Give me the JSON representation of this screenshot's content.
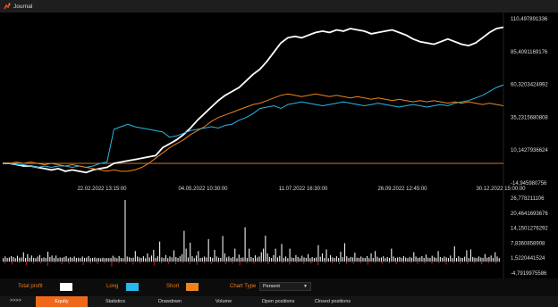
{
  "window": {
    "title": "Journal"
  },
  "chart_data": [
    {
      "type": "line",
      "title": "",
      "x_tick_labels": [
        "22.02.2022 13:15:00",
        "04.05.2022 10:30:00",
        "11.07.2022 16:30:00",
        "26.09.2022 12:45:00",
        "30.12.2022 15:00:00"
      ],
      "y_tick_labels": [
        "110,497891336",
        "85,4091169176",
        "60,3203424992",
        "35,2315680808",
        "10,1427936624",
        "-14,945980756"
      ],
      "ylim": [
        -14.95,
        110.5
      ],
      "baseline": 0,
      "grid": false,
      "series": [
        {
          "name": "Total profit",
          "color": "#ffffff",
          "values": [
            0,
            0,
            -1,
            -2,
            -2,
            -3,
            -4,
            -5,
            -4,
            -6,
            -5,
            -6,
            -7,
            -5,
            -4,
            -3,
            0,
            1,
            2,
            3,
            4,
            5,
            6,
            12,
            15,
            18,
            22,
            27,
            33,
            38,
            43,
            48,
            52,
            55,
            58,
            63,
            68,
            72,
            78,
            85,
            92,
            96,
            97,
            96,
            98,
            100,
            101,
            100,
            102,
            101,
            103,
            102,
            101,
            99,
            100,
            101,
            102,
            100,
            98,
            95,
            93,
            92,
            91,
            93,
            95,
            93,
            91,
            90,
            92,
            96,
            100,
            103,
            104
          ]
        },
        {
          "name": "Long",
          "color": "#29b6e8",
          "values": [
            0,
            0,
            -1,
            -1,
            -2,
            -3,
            -2,
            -3,
            -2,
            -2,
            -3,
            -2,
            -3,
            -2,
            0,
            1,
            26,
            28,
            30,
            28,
            27,
            26,
            25,
            24,
            20,
            21,
            23,
            25,
            26,
            27,
            28,
            27,
            29,
            30,
            33,
            35,
            38,
            42,
            43,
            44,
            42,
            45,
            46,
            47,
            46,
            45,
            44,
            45,
            46,
            47,
            46,
            45,
            44,
            45,
            46,
            45,
            44,
            43,
            44,
            45,
            44,
            43,
            44,
            45,
            44,
            46,
            47,
            48,
            50,
            52,
            55,
            58,
            60
          ]
        },
        {
          "name": "Short",
          "color": "#ee8420",
          "values": [
            0,
            0,
            1,
            0,
            1,
            0,
            -1,
            0,
            -1,
            -2,
            -1,
            -2,
            -3,
            -4,
            -5,
            -6,
            -5,
            -6,
            -6,
            -5,
            -3,
            0,
            4,
            8,
            12,
            15,
            18,
            22,
            25,
            28,
            32,
            35,
            37,
            39,
            41,
            43,
            45,
            46,
            48,
            50,
            52,
            53,
            52,
            51,
            52,
            53,
            52,
            51,
            52,
            51,
            50,
            51,
            50,
            49,
            50,
            49,
            48,
            49,
            48,
            47,
            48,
            47,
            48,
            47,
            46,
            47,
            46,
            47,
            46,
            45,
            46,
            45,
            44
          ]
        }
      ]
    },
    {
      "type": "bar",
      "title": "",
      "y_tick_labels": [
        "26,778211106",
        "20,4641693676",
        "14,1501276292",
        "7,8360858908",
        "1,5220441524",
        "-4,7919975586"
      ],
      "ylim": [
        -4.79,
        26.78
      ],
      "values": [
        1.5,
        2.2,
        1.6,
        1.8,
        2.4,
        2.0,
        1.5,
        2.5,
        1.7,
        1.8,
        4.0,
        1.6,
        3.2,
        1.7,
        2.6,
        1.6,
        1.5,
        2.2,
        2.8,
        1.5,
        1.8,
        1.6,
        4.2,
        2.0,
        2.6,
        1.6,
        2.6,
        1.5,
        1.8,
        1.6,
        2.0,
        2.4,
        1.5,
        1.9,
        1.6,
        2.2,
        1.6,
        1.7,
        1.5,
        2.2,
        1.6,
        1.7,
        2.4,
        1.5,
        1.6,
        1.8,
        1.5,
        1.6,
        1.4,
        1.7,
        1.5,
        1.6,
        1.5,
        1.6,
        2.5,
        1.8,
        1.5,
        2.4,
        1.6,
        1.5,
        26.0,
        2.2,
        1.9,
        1.6,
        1.7,
        4.5,
        2.2,
        1.8,
        1.6,
        2.3,
        1.5,
        3.5,
        1.8,
        2.6,
        5.0,
        1.6,
        2.3,
        8.5,
        1.8,
        1.6,
        2.8,
        1.5,
        2.2,
        1.8,
        4.8,
        2.0,
        1.6,
        2.3,
        3.2,
        13.0,
        5.5,
        1.8,
        8.0,
        2.3,
        1.5,
        2.6,
        4.5,
        1.6,
        1.7,
        2.2,
        1.8,
        9.5,
        2.0,
        1.6,
        5.0,
        2.2,
        1.7,
        1.6,
        10.8,
        3.5,
        1.8,
        2.2,
        1.6,
        2.0,
        5.5,
        1.5,
        3.0,
        1.7,
        1.8,
        14.5,
        1.6,
        5.5,
        2.0,
        1.6,
        2.7,
        1.8,
        2.2,
        4.0,
        5.5,
        11.0,
        3.5,
        2.0,
        1.6,
        2.8,
        5.5,
        1.8,
        2.5,
        7.5,
        1.6,
        2.2,
        1.5,
        5.5,
        1.8,
        1.6,
        2.8,
        2.0,
        1.5,
        2.5,
        1.8,
        1.6,
        3.2,
        1.5,
        2.0,
        1.6,
        1.8,
        7.0,
        2.1,
        3.5,
        1.6,
        5.2,
        1.5,
        2.8,
        1.8,
        1.6,
        2.3,
        1.6,
        4.2,
        1.9,
        7.8,
        2.3,
        1.6,
        2.0,
        1.8,
        3.8,
        1.7,
        1.6,
        2.2,
        1.7,
        1.6,
        2.4,
        1.5,
        3.5,
        1.6,
        4.5,
        2.1,
        1.6,
        1.8,
        2.3,
        1.5,
        2.0,
        1.6,
        5.5,
        2.2,
        1.6,
        1.8,
        2.0,
        1.6,
        2.4,
        1.8,
        1.5,
        2.0,
        1.7,
        4.0,
        2.2,
        1.6,
        1.8,
        2.4,
        1.6,
        3.0,
        1.7,
        1.6,
        2.5,
        1.9,
        1.6,
        4.5,
        2.0,
        1.6,
        2.2,
        1.8,
        1.6,
        2.6,
        1.5,
        6.5,
        1.6,
        2.3,
        1.7,
        1.6,
        2.1,
        4.8,
        1.6,
        5.2,
        2.0,
        1.7,
        1.6,
        2.2,
        1.8,
        1.6,
        3.2,
        1.7,
        2.0,
        2.6,
        1.6,
        4.0,
        2.2,
        1.5
      ],
      "neg_values": [
        -0.8,
        -1.2,
        -0.6,
        -1.5,
        -0.9,
        -0.7,
        -1.8,
        -0.5,
        -1.1,
        -0.9,
        -0.6,
        -1.4,
        -0.8,
        -1.0,
        -0.7,
        -2.0,
        -0.6,
        -0.9,
        -1.2,
        -0.8,
        -0.5,
        -1.6,
        -0.7,
        -0.9,
        -1.1,
        -0.6,
        -0.8,
        -1.3,
        -0.7,
        -0.9,
        -0.6,
        -1.0,
        -0.8,
        -1.5,
        -0.7,
        -0.9,
        -0.6,
        -1.1,
        -0.8,
        -0.7,
        -1.2,
        -0.6,
        -0.9,
        -0.8,
        -1.4,
        -0.7,
        -0.6,
        -1.0,
        -0.9,
        -0.8,
        -0.7,
        -1.3,
        -0.6,
        -0.9,
        -0.8,
        -1.1,
        -0.7,
        -0.6,
        -1.0,
        -0.8,
        -0.9,
        -0.7,
        -1.2,
        -0.6,
        -0.8,
        -0.9,
        -0.7,
        -1.1,
        -0.6,
        -0.8
      ]
    }
  ],
  "legend": {
    "total_profit_label": "Total profit",
    "long_label": "Long",
    "short_label": "Short",
    "chart_type_label": "Chart Type",
    "chart_type_value": "Persent",
    "total_color": "#ffffff",
    "long_color": "#29b6e8",
    "short_color": "#ee8420"
  },
  "tabs": {
    "more": ">>>>",
    "items": [
      {
        "label": "Equity",
        "active": true
      },
      {
        "label": "Statistics",
        "active": false
      },
      {
        "label": "Drawdown",
        "active": false
      },
      {
        "label": "Volume",
        "active": false
      },
      {
        "label": "Open positions",
        "active": false
      },
      {
        "label": "Closed positions",
        "active": false
      }
    ]
  },
  "icons": {
    "app": "journal-app-icon",
    "dropdown": "chevron-down-icon"
  }
}
